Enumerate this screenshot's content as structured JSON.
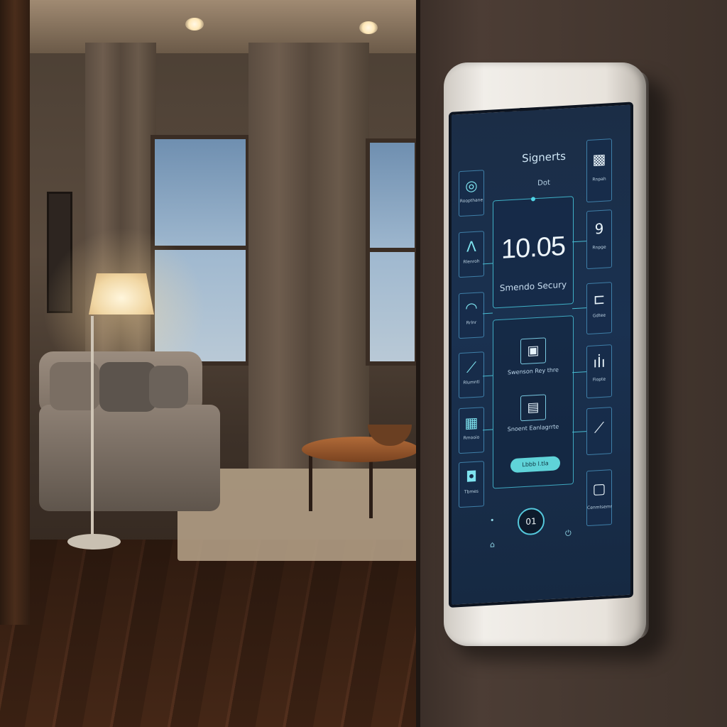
{
  "screen": {
    "title": "Signerts",
    "subtitle": "Dot",
    "clock": {
      "time": "10.05",
      "label": "Smendo Secury"
    },
    "center_items": [
      {
        "label": "Swenson Rey thre",
        "icon": "lock-doc-icon"
      },
      {
        "label": "Snoent Eanlagrrte",
        "icon": "document-icon"
      }
    ],
    "pill_button": "Lbbb l.tla",
    "bottom_button": "01",
    "left_tiles": [
      {
        "label": "Roopthane",
        "icon": "wifi-icon"
      },
      {
        "label": "Rlenroh",
        "icon": "tent-icon"
      },
      {
        "label": "Rrlnr",
        "icon": "gauge-icon"
      },
      {
        "label": "Rlumnti",
        "icon": "signal-icon"
      },
      {
        "label": "Rmooio",
        "icon": "panel-icon"
      },
      {
        "label": "Tbmes",
        "icon": "bag-icon"
      }
    ],
    "right_tiles": [
      {
        "label": "Rnpah",
        "icon": "qr-icon"
      },
      {
        "label": "Rnpge",
        "icon": "number-9-icon"
      },
      {
        "label": "Gdtee",
        "icon": "device-icon"
      },
      {
        "label": "Fiopte",
        "icon": "bars-icon"
      },
      {
        "label": "",
        "icon": "wand-icon"
      },
      {
        "label": "Cenmtsemr",
        "icon": "frame-icon"
      }
    ],
    "accent_color": "#4fd4e6",
    "screen_color": "#1a3150"
  }
}
